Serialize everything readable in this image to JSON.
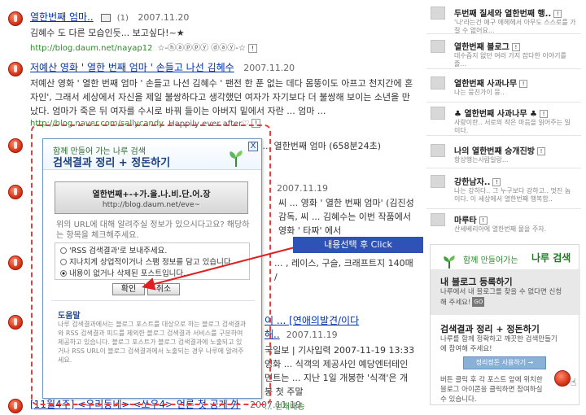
{
  "results": [
    {
      "title": "열한번째 엄마..",
      "count": "(1)",
      "date": "2007.11.20",
      "desc": "김혜수 도 다른 모습인듯... 보고싶다!~★",
      "url": "http://blog.daum.net/nayap12",
      "blog": "☆-ⓗⓐⓟⓟⓨ ⓓⓐⓨ-☆"
    },
    {
      "title": "저예산 영화 ' 열한 번째 엄마 ' 손들고 나선 김혜수",
      "date": "2007.11.20",
      "desc": "저예산 영화 ' 열한 번째 엄마 ' 손들고 나선 김혜수 ' 팬전 한 푼 없는 데다 몸뚱이도 아프고 천지간에 혼자인', 그래서 세상에서 자신을 제일 불쌍하다고 생각했던 여자가 자기보다 더 불쌍해 보이는 소년을 만났다. 엄마가 죽은 뒤 여자를 수시로 바꿔 들이는 아버지 밑에서 자란 ... 엄마 ...",
      "url": "http://blog.naver.com/sallycandy",
      "blog": "Happily ever after♡"
    },
    {
      "title": "아",
      "desc": "20 ... 열한번째 엄마 (658분24초)",
      "url": "ht"
    },
    {
      "title": "필",
      "date": "2007.11.19",
      "desc": "씨 ... 영화 ' 열한 번째 엄마' (김진성 감독, 씨 ... 김혜수는 이번 작품에서 영화 ' 타짜' 에서",
      "url": "ht"
    },
    {
      "title": "",
      "desc": "... , 레이스, 구슬, 크래프트지 140매 /"
    },
    {
      "title": "이 ... [연애의발견/이다해..",
      "date": "2007.11.19",
      "desc": "국일보 | 기사입력 2007-11-19 13:33 영화 ... 식객의 제공사인 예당엔터테인먼트는 ... 지난 1일 개봉한 '식객'은 개봉 첫 주말",
      "url": "... 번개배송"
    },
    {
      "title": "[11월4주] <우리동네> <쏘우4> 언론 첫 공개 外",
      "date": "2007.11.19"
    }
  ],
  "dialog": {
    "subtitle": "함께 만들어 가는 나루 검색",
    "title": "검색결과 정리 + 정돈하기",
    "close": "X",
    "url_name": "열한번째+-+가.을.나.비.단.어.장",
    "url_link": "http://blog.daum.net/eve~",
    "question": "위의 URL에 대해 알려주실 정보가 있으시다고요? 해당하는 항목을 체크해주세요.",
    "options": [
      "'RSS 검색결과'로 보내주세요.",
      "지나치게 상업적이거나 스팸 정보를 담고 있습니다.",
      "내용이 없거나 삭제된 포스트입니다."
    ],
    "selected_option": 2,
    "ok": "확인",
    "cancel": "취소",
    "help_title": "도움말",
    "help_body": "나루 검색결과에서는 블로그 포스트를 대상으로 하는 블로그 검색결과와 RSS 검색결과 피드를 제외한 블로그 검색결과 서비스를 구분하여 제공하고 있습니다. 블로그 포스트가 블로그 검색결과에 노출되고 있거나 RSS URL이 블로그 검색결과에서 노출되는 경우 나루에 알려주세요."
  },
  "callout": "내용선택 후 Click",
  "comments": [
    {
      "title": "두번째 질세와 열한번째 행..",
      "text": "'나'라는건 애구 에헤헤서 아무도 스스로를 가질 수 없어요..."
    },
    {
      "title": "열한번째 블로그",
      "text": "데수즘지 없던 여러 가지 잡다한 이야기를 즐..."
    },
    {
      "title": "열한번째 사과나무",
      "text": "나는 뭉친가이 뭉.."
    },
    {
      "title": "♣ 열한번째 사과나무 ♣",
      "text": "사랑이란.. 서로의 작은 마음을 읽어주는 일이다."
    },
    {
      "title": "나의 열한번째 승개진방",
      "text": "항상행는사람일랑..."
    },
    {
      "title": "강한남자..",
      "text": "나는 강하다.. 그 누구보다 강하고.. 멋진 놈이다. 이 세상에서 열한번째 행복함.."
    },
    {
      "title": "마루타",
      "text": "산세베리아에 열한번째 물을 주자."
    }
  ],
  "promo": {
    "subtitle": "함께 만들어가는",
    "brand": "나루 검색",
    "h1": "내 블로그 등록하기",
    "p1": "나루에서 내 블로그를 찾을 수 없다면 신청해 주세요!",
    "go": "GO",
    "h2": "검색결과 정리 + 정돈하기",
    "p2": "나루를 함께 정확하고 깨끗한 검색만들기에 참여해 주세요!",
    "btn": "정리정돈 사용하기 →",
    "p3": "버튼 클릭 후 각 포스트 앞에 위치한 블로그 아이콘을 클릭하면 참여하실 수 있습니다."
  },
  "colors": {
    "link": "#0033aa",
    "url": "#2a8a2a",
    "dash": "#e04040",
    "callout": "#2e52b6",
    "arrow": "#e02020"
  }
}
